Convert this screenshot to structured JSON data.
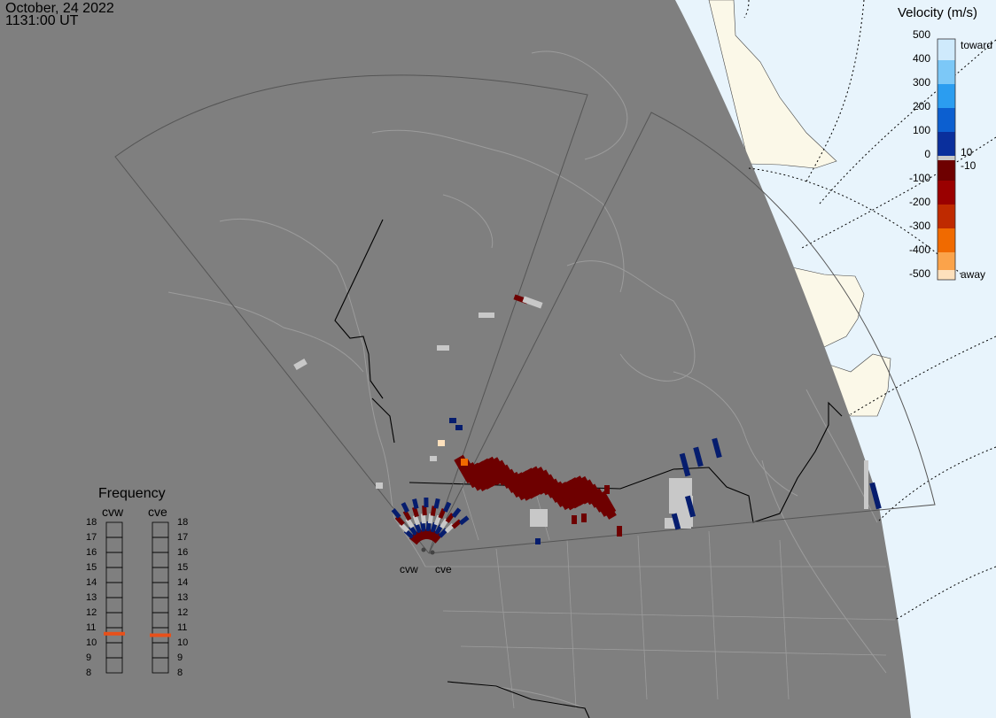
{
  "header": {
    "date": "October, 24 2022",
    "time": "1131:00 UT"
  },
  "velocity_scale": {
    "title": "Velocity (m/s)",
    "ticks": [
      "500",
      "400",
      "300",
      "200",
      "100",
      "0",
      "-100",
      "-200",
      "-300",
      "-400",
      "-500"
    ],
    "toward_label": "toward",
    "away_label": "away",
    "inner_top": "10",
    "inner_bottom": "-10",
    "colors": {
      "toward_500": "#cfeafc",
      "toward_400": "#7cc8f7",
      "toward_300": "#2b9df0",
      "toward_200": "#0c5fd0",
      "toward_100": "#0a2f9c",
      "toward_10": "#061d6e",
      "ground": "#c8c8c8",
      "away_10": "#6e0000",
      "away_100": "#9a0000",
      "away_200": "#bf2a00",
      "away_300": "#f06a00",
      "away_400": "#fba34a",
      "away_500": "#fde0bc"
    }
  },
  "frequency_panel": {
    "title": "Frequency",
    "radars": [
      "cvw",
      "cve"
    ],
    "values_mhz": [
      "18",
      "17",
      "16",
      "15",
      "14",
      "13",
      "12",
      "11",
      "10",
      "9",
      "8"
    ],
    "cvw_frequency": 10.6,
    "cve_frequency": 10.5,
    "indicator_color": "#e8501a"
  },
  "sites": [
    "cvw",
    "cve"
  ],
  "map_colors": {
    "night": "#7f7f7f",
    "land": "#fbf8e8",
    "ocean": "#e8f4fc",
    "fov": "#555555"
  }
}
